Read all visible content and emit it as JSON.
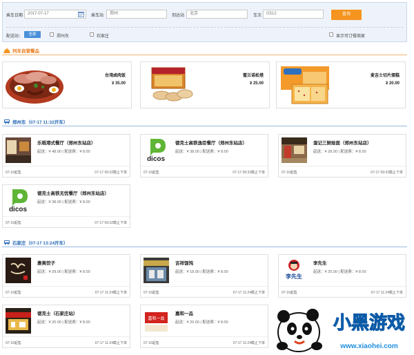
{
  "search": {
    "date_label": "乘车日期",
    "date_value": "2017-07-17",
    "board_label": "乘车站",
    "board_value": "郑州",
    "arrive_label": "到达站",
    "arrive_value": "北京",
    "train_label": "车次",
    "train_value": "G512",
    "query_button": "查询",
    "delivery_label": "配送站：",
    "all_label": "全部",
    "stations": [
      "郑州东",
      "石家庄"
    ],
    "show_only_label": "显示可订餐商家"
  },
  "sections": {
    "onboard": "列车自营餐品",
    "zhengzhou": "郑州东（07-17 11:32开车）",
    "shijiazhuang": "石家庄（07-17 13:24开车）"
  },
  "products": [
    {
      "name": "台湾卤肉饭",
      "price": "¥ 35.00"
    },
    {
      "name": "蜜兰诺松塔",
      "price": "¥ 25.00"
    },
    {
      "name": "麦吉士切片蛋糕",
      "price": "¥ 20.00"
    }
  ],
  "zz_shops": [
    {
      "name": "乐稻港式餐厅（郑州东站店）",
      "fee": "起送：¥ 48.00 | 配送费：¥ 8.00",
      "date": "07-16起售",
      "deadline": "07-17 09:32截止下单"
    },
    {
      "name": "德克士高铁逸臣餐厅（郑州东站店）",
      "fee": "起送：¥ 38.00 | 配送费：¥ 8.00",
      "date": "07-16起售",
      "deadline": "07-17 09:32截止下单",
      "logo_text": "dicos"
    },
    {
      "name": "蛋记三鲜烩面（郑州东站店）",
      "fee": "起送：¥ 28.00 | 配送费：¥ 8.00",
      "date": "07-16起售",
      "deadline": "07-17 09:32截止下单"
    },
    {
      "name": "德克士高铁无忧餐厅（郑州东站店）",
      "fee": "起送：¥ 38.00 | 配送费：¥ 8.00",
      "date": "07-16起售",
      "deadline": "07-17 09:32截止下单",
      "logo_text": "dicos"
    }
  ],
  "sjz_shops": [
    {
      "name": "惠美饺子",
      "fee": "起送：¥ 28.00 | 配送费：¥ 8.00",
      "date": "07-16起售",
      "deadline": "07-17 11:24截止下单"
    },
    {
      "name": "吉祥馄饨",
      "fee": "起送：¥ 18.00 | 配送费：¥ 8.00",
      "date": "07-16起售",
      "deadline": "07-17 11:24截止下单"
    },
    {
      "name": "李先生",
      "fee": "起送：¥ 25.00 | 配送费：¥ 8.00",
      "date": "07-16起售",
      "deadline": "07-17 11:24截止下单",
      "logo_text": "李先生"
    },
    {
      "name": "德克士（石家庄站）",
      "fee": "起送：¥ 20.00 | 配送费：¥ 8.00",
      "date": "07-16起售",
      "deadline": "07-17 11:24截止下单"
    },
    {
      "name": "嘉和一品",
      "fee": "起送：¥ 20.00 | 配送费：¥ 8.00",
      "date": "07-16起售",
      "deadline": "07-17 11:24截止下单",
      "logo_text": "嘉和一品"
    }
  ],
  "watermark": {
    "brand": "小黑游戏",
    "url": "www.xiaohei.com"
  },
  "colors": {
    "accent": "#f5941f",
    "blue": "#2b6cb8",
    "orange_title": "#e87a1a"
  }
}
